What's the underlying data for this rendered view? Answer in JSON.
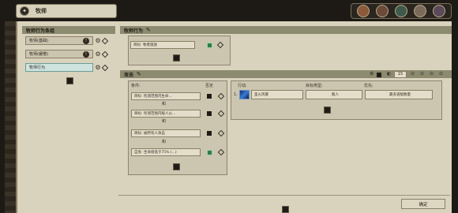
{
  "window": {
    "title": "牧师",
    "title_icon": "ability-icon"
  },
  "portraits": [
    "#8a5a3a",
    "#6b4a3a",
    "#3d5a4a",
    "#7a6a5a",
    "#5a4a5a"
  ],
  "left": {
    "header": "牧师行为条组",
    "items": [
      {
        "label": "牧师(基础)"
      },
      {
        "label": "牧师(缓慢)"
      },
      {
        "label": "牧师行为"
      }
    ]
  },
  "behavior": {
    "header": "牧师行为",
    "target_field": "目标: 牧者施放"
  },
  "attack": {
    "header": "攻击",
    "conditions_label": "条件:",
    "negate_label": "否定",
    "conditions": [
      "目标: 检测范围内生命...",
      "目标: 检测范围内敌人以...",
      "目标: 被所有人攻击",
      "自身: 生命值低于75% (...)"
    ],
    "conj": "和",
    "action_label": "行动:",
    "target_type_label": "目标类型:",
    "priority_label": "优先:",
    "action_row": {
      "index": "1.",
      "ability": "圣火风暴",
      "target_type": "敌人",
      "priority": "最多道敌数量"
    },
    "cooldown_value": "15"
  },
  "confirm_label": "确定"
}
